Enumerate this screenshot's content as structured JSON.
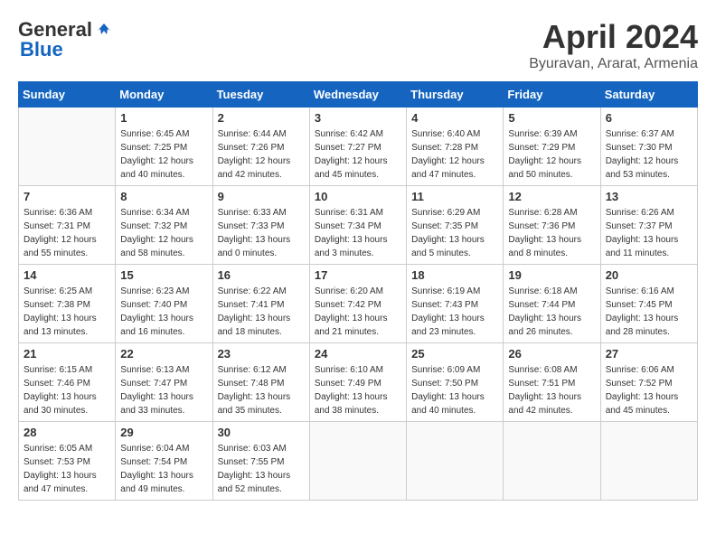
{
  "header": {
    "logo": {
      "part1": "General",
      "part2": "Blue"
    },
    "title": "April 2024",
    "location": "Byuravan, Ararat, Armenia"
  },
  "calendar": {
    "weekdays": [
      "Sunday",
      "Monday",
      "Tuesday",
      "Wednesday",
      "Thursday",
      "Friday",
      "Saturday"
    ],
    "weeks": [
      [
        {
          "day": "",
          "empty": true
        },
        {
          "day": "1",
          "sunrise": "Sunrise: 6:45 AM",
          "sunset": "Sunset: 7:25 PM",
          "daylight": "Daylight: 12 hours and 40 minutes."
        },
        {
          "day": "2",
          "sunrise": "Sunrise: 6:44 AM",
          "sunset": "Sunset: 7:26 PM",
          "daylight": "Daylight: 12 hours and 42 minutes."
        },
        {
          "day": "3",
          "sunrise": "Sunrise: 6:42 AM",
          "sunset": "Sunset: 7:27 PM",
          "daylight": "Daylight: 12 hours and 45 minutes."
        },
        {
          "day": "4",
          "sunrise": "Sunrise: 6:40 AM",
          "sunset": "Sunset: 7:28 PM",
          "daylight": "Daylight: 12 hours and 47 minutes."
        },
        {
          "day": "5",
          "sunrise": "Sunrise: 6:39 AM",
          "sunset": "Sunset: 7:29 PM",
          "daylight": "Daylight: 12 hours and 50 minutes."
        },
        {
          "day": "6",
          "sunrise": "Sunrise: 6:37 AM",
          "sunset": "Sunset: 7:30 PM",
          "daylight": "Daylight: 12 hours and 53 minutes."
        }
      ],
      [
        {
          "day": "7",
          "sunrise": "Sunrise: 6:36 AM",
          "sunset": "Sunset: 7:31 PM",
          "daylight": "Daylight: 12 hours and 55 minutes."
        },
        {
          "day": "8",
          "sunrise": "Sunrise: 6:34 AM",
          "sunset": "Sunset: 7:32 PM",
          "daylight": "Daylight: 12 hours and 58 minutes."
        },
        {
          "day": "9",
          "sunrise": "Sunrise: 6:33 AM",
          "sunset": "Sunset: 7:33 PM",
          "daylight": "Daylight: 13 hours and 0 minutes."
        },
        {
          "day": "10",
          "sunrise": "Sunrise: 6:31 AM",
          "sunset": "Sunset: 7:34 PM",
          "daylight": "Daylight: 13 hours and 3 minutes."
        },
        {
          "day": "11",
          "sunrise": "Sunrise: 6:29 AM",
          "sunset": "Sunset: 7:35 PM",
          "daylight": "Daylight: 13 hours and 5 minutes."
        },
        {
          "day": "12",
          "sunrise": "Sunrise: 6:28 AM",
          "sunset": "Sunset: 7:36 PM",
          "daylight": "Daylight: 13 hours and 8 minutes."
        },
        {
          "day": "13",
          "sunrise": "Sunrise: 6:26 AM",
          "sunset": "Sunset: 7:37 PM",
          "daylight": "Daylight: 13 hours and 11 minutes."
        }
      ],
      [
        {
          "day": "14",
          "sunrise": "Sunrise: 6:25 AM",
          "sunset": "Sunset: 7:38 PM",
          "daylight": "Daylight: 13 hours and 13 minutes."
        },
        {
          "day": "15",
          "sunrise": "Sunrise: 6:23 AM",
          "sunset": "Sunset: 7:40 PM",
          "daylight": "Daylight: 13 hours and 16 minutes."
        },
        {
          "day": "16",
          "sunrise": "Sunrise: 6:22 AM",
          "sunset": "Sunset: 7:41 PM",
          "daylight": "Daylight: 13 hours and 18 minutes."
        },
        {
          "day": "17",
          "sunrise": "Sunrise: 6:20 AM",
          "sunset": "Sunset: 7:42 PM",
          "daylight": "Daylight: 13 hours and 21 minutes."
        },
        {
          "day": "18",
          "sunrise": "Sunrise: 6:19 AM",
          "sunset": "Sunset: 7:43 PM",
          "daylight": "Daylight: 13 hours and 23 minutes."
        },
        {
          "day": "19",
          "sunrise": "Sunrise: 6:18 AM",
          "sunset": "Sunset: 7:44 PM",
          "daylight": "Daylight: 13 hours and 26 minutes."
        },
        {
          "day": "20",
          "sunrise": "Sunrise: 6:16 AM",
          "sunset": "Sunset: 7:45 PM",
          "daylight": "Daylight: 13 hours and 28 minutes."
        }
      ],
      [
        {
          "day": "21",
          "sunrise": "Sunrise: 6:15 AM",
          "sunset": "Sunset: 7:46 PM",
          "daylight": "Daylight: 13 hours and 30 minutes."
        },
        {
          "day": "22",
          "sunrise": "Sunrise: 6:13 AM",
          "sunset": "Sunset: 7:47 PM",
          "daylight": "Daylight: 13 hours and 33 minutes."
        },
        {
          "day": "23",
          "sunrise": "Sunrise: 6:12 AM",
          "sunset": "Sunset: 7:48 PM",
          "daylight": "Daylight: 13 hours and 35 minutes."
        },
        {
          "day": "24",
          "sunrise": "Sunrise: 6:10 AM",
          "sunset": "Sunset: 7:49 PM",
          "daylight": "Daylight: 13 hours and 38 minutes."
        },
        {
          "day": "25",
          "sunrise": "Sunrise: 6:09 AM",
          "sunset": "Sunset: 7:50 PM",
          "daylight": "Daylight: 13 hours and 40 minutes."
        },
        {
          "day": "26",
          "sunrise": "Sunrise: 6:08 AM",
          "sunset": "Sunset: 7:51 PM",
          "daylight": "Daylight: 13 hours and 42 minutes."
        },
        {
          "day": "27",
          "sunrise": "Sunrise: 6:06 AM",
          "sunset": "Sunset: 7:52 PM",
          "daylight": "Daylight: 13 hours and 45 minutes."
        }
      ],
      [
        {
          "day": "28",
          "sunrise": "Sunrise: 6:05 AM",
          "sunset": "Sunset: 7:53 PM",
          "daylight": "Daylight: 13 hours and 47 minutes."
        },
        {
          "day": "29",
          "sunrise": "Sunrise: 6:04 AM",
          "sunset": "Sunset: 7:54 PM",
          "daylight": "Daylight: 13 hours and 49 minutes."
        },
        {
          "day": "30",
          "sunrise": "Sunrise: 6:03 AM",
          "sunset": "Sunset: 7:55 PM",
          "daylight": "Daylight: 13 hours and 52 minutes."
        },
        {
          "day": "",
          "empty": true
        },
        {
          "day": "",
          "empty": true
        },
        {
          "day": "",
          "empty": true
        },
        {
          "day": "",
          "empty": true
        }
      ]
    ]
  }
}
